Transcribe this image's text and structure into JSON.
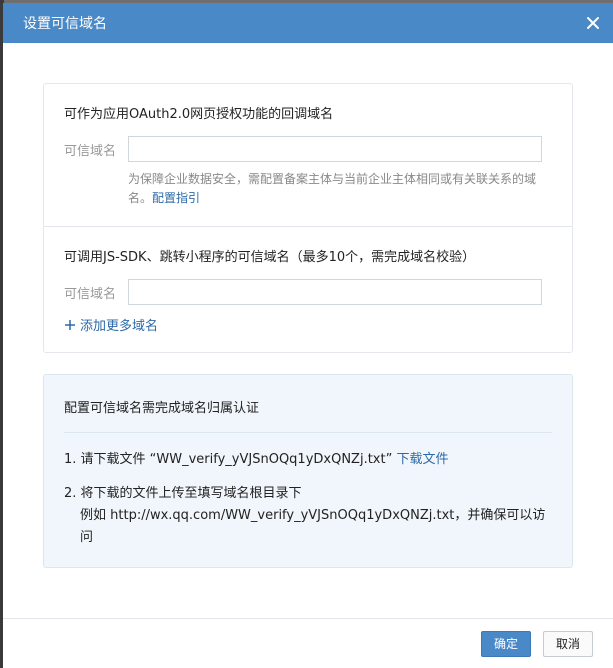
{
  "dialog": {
    "title": "设置可信域名"
  },
  "oauth": {
    "title": "可作为应用OAuth2.0网页授权功能的回调域名",
    "field_label": "可信域名",
    "value": "",
    "hint_text": "为保障企业数据安全，需配置备案主体与当前企业主体相同或有关联关系的域名。",
    "hint_link": "配置指引"
  },
  "jssdk": {
    "title": "可调用JS-SDK、跳转小程序的可信域名（最多10个，需完成域名校验）",
    "field_label": "可信域名",
    "value": "",
    "add_more": "添加更多域名"
  },
  "verify": {
    "title": "配置可信域名需完成域名归属认证",
    "step1_text": "1. 请下载文件 “WW_verify_yVJSnOQq1yDxQNZj.txt”",
    "step1_link": "下载文件",
    "step2_line1": "2. 将下载的文件上传至填写域名根目录下",
    "step2_line2": "例如 http://wx.qq.com/WW_verify_yVJSnOQq1yDxQNZj.txt，并确保可以访问"
  },
  "footer": {
    "confirm_label": "确定",
    "cancel_label": "取消"
  },
  "colors": {
    "header": "#4a89c8",
    "link": "#2c6aa7",
    "info_bg": "#f0f6fb"
  },
  "icons": {
    "close": "close-icon",
    "add": "plus-icon"
  }
}
